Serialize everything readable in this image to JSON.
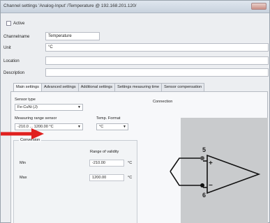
{
  "window": {
    "title": "Channel settings 'Analog-Input' /Temperature @ 192.168.201.120/"
  },
  "active": {
    "label": "Active"
  },
  "fields": [
    {
      "label": "Channelname",
      "value": "Temperature"
    },
    {
      "label": "Unit",
      "value": "°C"
    },
    {
      "label": "Location",
      "value": ""
    },
    {
      "label": "Description",
      "value": ""
    }
  ],
  "tabs": [
    "Main settings",
    "Advanced settings",
    "Additional settings",
    "Settings measuring time",
    "Sensor compensation"
  ],
  "main": {
    "sensor_type_label": "Sensor type",
    "sensor_type_value": "Fe-CuNi (J)",
    "range_label": "Measuring range sensor",
    "range_value": "-210.0 ... 1200.00 °C",
    "temp_format_label": "Temp. Format",
    "temp_format_value": "°C",
    "connection_label": "Connection"
  },
  "conversion": {
    "title": "Conversion",
    "range_header": "Range of validity",
    "min_label": "Min",
    "min_value": "-210.00",
    "min_unit": "°C",
    "max_label": "Max",
    "max_value": "1200.00",
    "max_unit": "°C"
  },
  "diagram": {
    "pin_top": "5",
    "pin_bottom": "6",
    "plus": "+",
    "minus": "−"
  },
  "colors": {
    "indicator_arrow": "#e0201f"
  }
}
